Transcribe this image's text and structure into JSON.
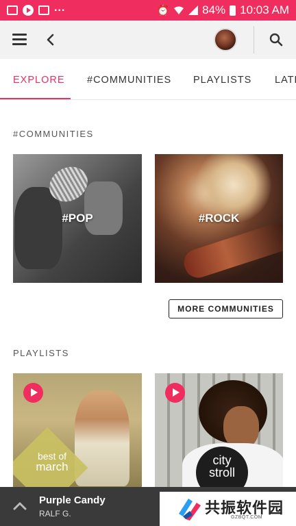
{
  "status_bar": {
    "battery": "84%",
    "time": "10:03 AM",
    "notification_dots": "...",
    "icons": [
      "image-icon",
      "media-play-icon",
      "message-icon",
      "alarm-icon",
      "wifi-icon",
      "signal-icon",
      "battery-icon"
    ]
  },
  "app_bar": {
    "icons": [
      "menu-icon",
      "back-arrow-icon",
      "user-avatar",
      "search-icon"
    ]
  },
  "tabs": [
    {
      "label": "EXPLORE",
      "active": true
    },
    {
      "label": "#COMMUNITIES",
      "active": false
    },
    {
      "label": "PLAYLISTS",
      "active": false
    },
    {
      "label": "LATEST",
      "active": false
    }
  ],
  "communities": {
    "title": "#COMMUNITIES",
    "items": [
      {
        "label": "#POP"
      },
      {
        "label": "#ROCK"
      }
    ],
    "more_button": "MORE COMMUNITIES"
  },
  "playlists": {
    "title": "PLAYLISTS",
    "items": [
      {
        "line1": "best of",
        "line2": "march"
      },
      {
        "line1": "city",
        "line2": "stroll"
      }
    ]
  },
  "player": {
    "title": "Purple Candy",
    "artist": "RALF G."
  },
  "watermark": {
    "text": "共振软件园",
    "sub": "GZBQT.COM"
  },
  "colors": {
    "accent": "#ef2d5e",
    "player_bg": "#3a3a3a",
    "app_bar_bg": "#f2f2f2"
  }
}
